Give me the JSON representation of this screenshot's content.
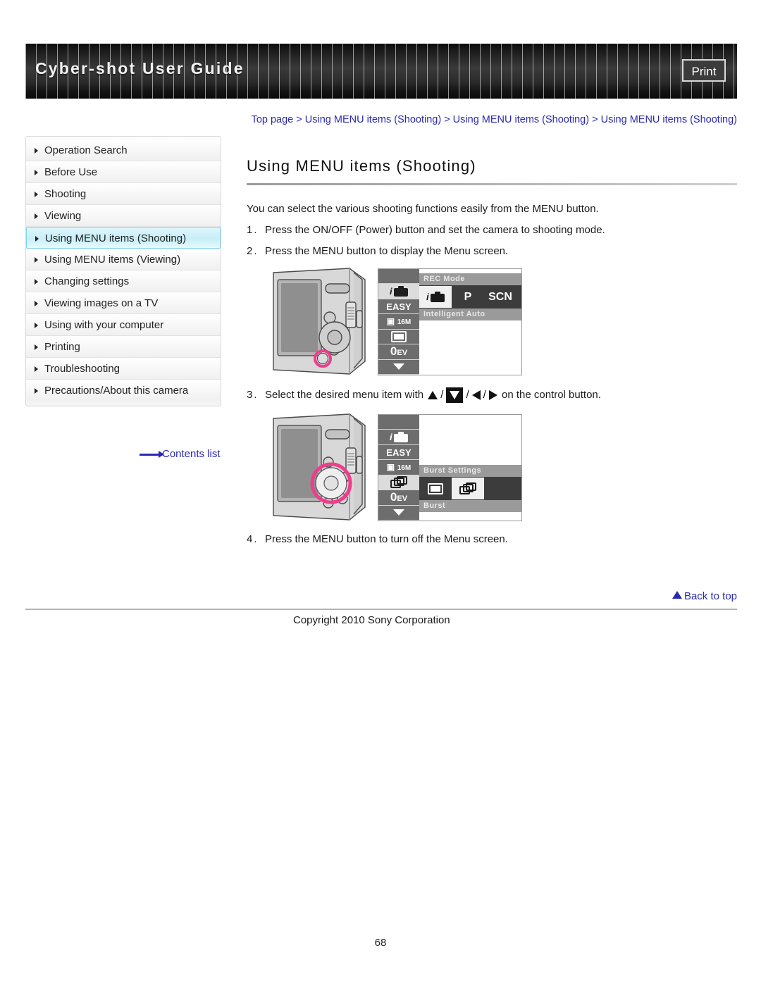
{
  "header": {
    "title": "Cyber-shot User Guide",
    "print_label": "Print"
  },
  "sidebar": {
    "items": [
      {
        "label": "Operation Search",
        "selected": false
      },
      {
        "label": "Before Use",
        "selected": false
      },
      {
        "label": "Shooting",
        "selected": false
      },
      {
        "label": "Viewing",
        "selected": false
      },
      {
        "label": "Using MENU items (Shooting)",
        "selected": true
      },
      {
        "label": "Using MENU items (Viewing)",
        "selected": false
      },
      {
        "label": "Changing settings",
        "selected": false
      },
      {
        "label": "Viewing images on a TV",
        "selected": false
      },
      {
        "label": "Using with your computer",
        "selected": false
      },
      {
        "label": "Printing",
        "selected": false
      },
      {
        "label": "Troubleshooting",
        "selected": false
      },
      {
        "label": "Precautions/About this camera",
        "selected": false
      }
    ],
    "contents_link": "Contents list"
  },
  "main": {
    "breadcrumb": "Top page > Using MENU items (Shooting) > Using MENU items (Shooting) > Using MENU items (Shooting)",
    "title": "Using MENU items (Shooting)",
    "intro": "You can select the various shooting functions easily from the MENU button.",
    "steps": [
      {
        "num": "1.",
        "text": "Press the ON/OFF (Power) button and set the camera to shooting mode."
      },
      {
        "num": "2.",
        "text": "Press the MENU button to display the Menu screen."
      },
      {
        "num": "3.",
        "text_before": "Select the desired menu item with",
        "text_after": "on the control button."
      },
      {
        "num": "4.",
        "text": "Press the MENU button to turn off the Menu screen."
      }
    ],
    "control_keys": {
      "up": "up-triangle",
      "down": "down-triangle-selected",
      "left": "left-triangle",
      "right": "right-triangle",
      "separator": "/"
    }
  },
  "figure1": {
    "caption_icon": "camera-rear-with-menu-button-highlighted",
    "lcd": {
      "left_column": [
        {
          "icon": "blank",
          "label": "",
          "selected": false
        },
        {
          "icon": "intelligent-auto-icon",
          "label": "",
          "selected": true
        },
        {
          "icon": "easy-mode-text",
          "label": "EASY",
          "selected": false
        },
        {
          "icon": "image-size-16m-icon",
          "label": "16M",
          "selected": false
        },
        {
          "icon": "single-shot-icon",
          "label": "",
          "selected": false
        },
        {
          "icon": "ev-compensation-icon",
          "label": "0EV",
          "selected": false
        },
        {
          "icon": "down-caret-icon",
          "label": "",
          "selected": false
        }
      ],
      "top_bar_label": "REC Mode",
      "options": [
        {
          "icon": "intelligent-auto-icon",
          "label": "",
          "selected": true
        },
        {
          "icon": "program-auto",
          "label": "P",
          "selected": false
        },
        {
          "icon": "scene-selection",
          "label": "SCN",
          "selected": false
        }
      ],
      "bottom_bar_label": "Intelligent Auto"
    }
  },
  "figure2": {
    "caption_icon": "camera-rear-with-control-button-highlighted",
    "lcd": {
      "left_column": [
        {
          "icon": "blank",
          "label": "",
          "selected": false
        },
        {
          "icon": "intelligent-auto-icon",
          "label": "",
          "selected": false
        },
        {
          "icon": "easy-mode-text",
          "label": "EASY",
          "selected": false
        },
        {
          "icon": "image-size-16m-icon",
          "label": "16M",
          "selected": false
        },
        {
          "icon": "burst-settings-icon",
          "label": "",
          "selected": true
        },
        {
          "icon": "ev-compensation-icon",
          "label": "0EV",
          "selected": false
        },
        {
          "icon": "down-caret-icon",
          "label": "",
          "selected": false
        }
      ],
      "top_bar_label": "Burst Settings",
      "options": [
        {
          "icon": "single-shot-icon",
          "label": "",
          "selected": false
        },
        {
          "icon": "burst-icon",
          "label": "",
          "selected": true
        }
      ],
      "bottom_bar_label": "Burst"
    }
  },
  "footer": {
    "back_to_top": "Back to top",
    "copyright": "Copyright 2010 Sony Corporation",
    "page_number": "68"
  },
  "colors": {
    "link": "#2a2ab0",
    "highlight": "#c7eef8",
    "highlight_border": "#7fd4e8",
    "header_bg": "#1a1a1a",
    "accent_pink": "#ef3d8c"
  }
}
